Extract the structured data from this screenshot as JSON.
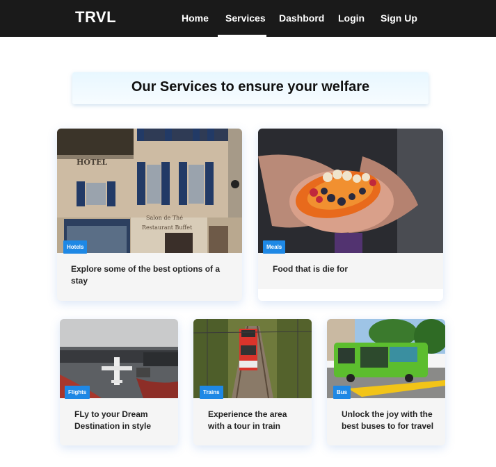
{
  "brand": "TRVL",
  "nav": [
    "Home",
    "Services",
    "Dashbord",
    "Login",
    "Sign Up"
  ],
  "active_nav": "Services",
  "heading": "Our Services to ensure your welfare",
  "cards": [
    {
      "badge": "Hotels",
      "text": "Explore some of the best options of a stay",
      "image": "hotel-facade"
    },
    {
      "badge": "Meals",
      "text": "Food that is die for",
      "image": "papaya-fruit-bowl"
    },
    {
      "badge": "Flights",
      "text": "FLy to your Dream Destination in style",
      "image": "airport-tarmac"
    },
    {
      "badge": "Trains",
      "text": "Experience the area with a tour in train",
      "image": "red-train-tracks"
    },
    {
      "badge": "Bus",
      "text": "Unlock the joy with the best buses to for travel",
      "image": "green-bus"
    }
  ],
  "colors": {
    "navbar": "#1a1a1a",
    "badge": "#1e88e5",
    "card": "#f5f5f5"
  }
}
